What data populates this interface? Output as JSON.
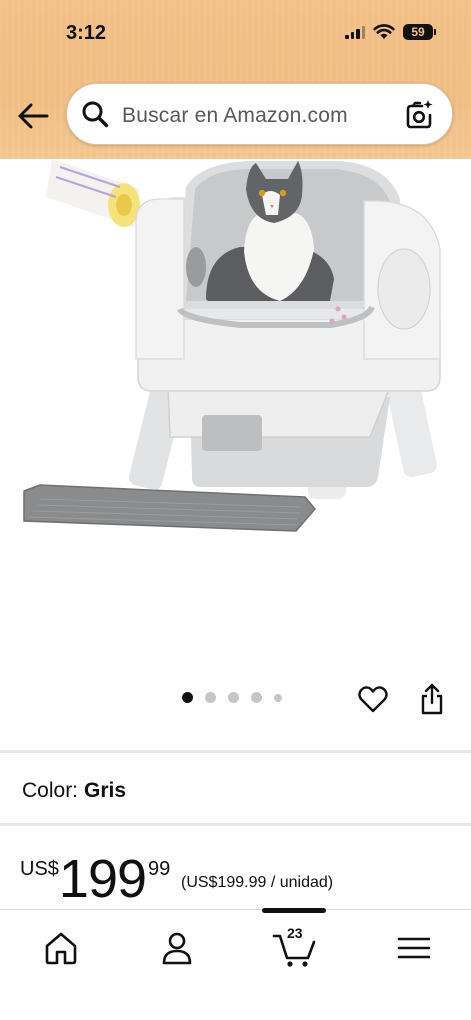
{
  "status_bar": {
    "time": "3:12",
    "battery": "59"
  },
  "search": {
    "placeholder": "Buscar en Amazon.com"
  },
  "gallery": {
    "image_count": 5,
    "active_index": 0
  },
  "product": {
    "color_label": "Color:",
    "color_value": "Gris",
    "price_currency": "US$",
    "price_whole": "199",
    "price_fraction": "99",
    "unit_price": "(US$199.99 / unidad)"
  },
  "nav": {
    "cart_count": "23"
  },
  "colors": {
    "header_bg": "#f2c088",
    "text": "#0f1111",
    "divider": "#e3e6e6"
  }
}
